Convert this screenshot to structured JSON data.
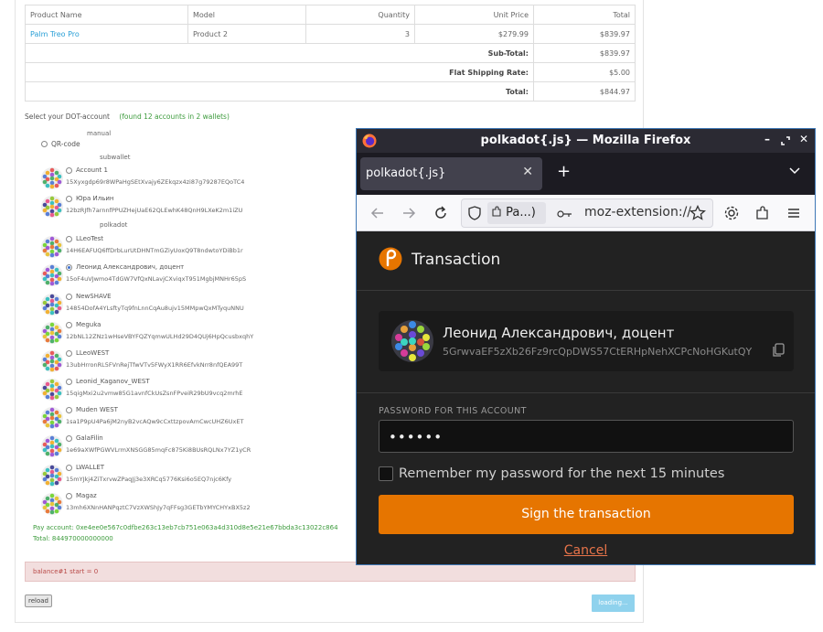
{
  "order_table": {
    "headers": [
      "Product Name",
      "Model",
      "Quantity",
      "Unit Price",
      "Total"
    ],
    "rows": [
      {
        "product": "Palm Treo Pro",
        "model": "Product 2",
        "quantity": "3",
        "unit_price": "$279.99",
        "total": "$839.97"
      }
    ],
    "totals": [
      {
        "label": "Sub-Total:",
        "value": "$839.97"
      },
      {
        "label": "Flat Shipping Rate:",
        "value": "$5.00"
      },
      {
        "label": "Total:",
        "value": "$844.97"
      }
    ]
  },
  "account_select": {
    "label": "Select your DOT-account",
    "found": "(found 12 accounts in 2 wallets)",
    "group_manual": "manual",
    "qr_label": "QR-code",
    "group_subwallet": "subwallet",
    "group_polkadot": "polkadot",
    "accounts": [
      {
        "name": "Account 1",
        "address": "15Xyxgdp69r8WPaHgSEtXvajy6ZEkqzx4zi87g79287EQoTC4",
        "selected": false
      },
      {
        "name": "Юра Ильин",
        "address": "12bzRJfh7arnnfPPUZHejUaE62QLEwhK48QnH9LXeK2m1iZU",
        "selected": false
      },
      {
        "name": "LLeoTest",
        "address": "14H6EAFUQ6ffDrbLurUtDHNTmGZiyUoxQ9T8ndwtoYDiBb1r",
        "selected": false
      },
      {
        "name": "Леонид Александрович, доцент",
        "address": "15oF4uVJwmo4TdGW7VfQxNLavjCXviqxT951MgbjMNHr65pS",
        "selected": true
      },
      {
        "name": "NewSHAVE",
        "address": "14854DofA4YLsftyTq9fnLnnCqAu8ujv15MMpwQxMTyquNNU",
        "selected": false
      },
      {
        "name": "Meguka",
        "address": "12bNL12ZNz1wHseVBYFQZYqmwULHd29D4QUj6HpQcusbxqhY",
        "selected": false
      },
      {
        "name": "LLeoWEST",
        "address": "13ubHrronRL5FVnRejTfwVTv5FWyX1RR6EfvkNrr8nfQEA99T",
        "selected": false
      },
      {
        "name": "Leonid_Kaganov_WEST",
        "address": "15qigMxi2u2vmw85G1avnfCkUsZsnFPveiR29bU9vcq2mrhE",
        "selected": false
      },
      {
        "name": "Muden WEST",
        "address": "1sa1P9pU4Pa6jM2nyB2vcAQw9cCxttzpovAmCwcUHZ6UxET",
        "selected": false
      },
      {
        "name": "GalaFilin",
        "address": "1e69aXWfPGWVLrmXNSGG85mqFc875Ki8BUsRQLNx7YZ1yCR",
        "selected": false
      },
      {
        "name": "LWALLET",
        "address": "15mYJkj4ZiTxrvwZPaqJj3e3XRCq5776Ksi6o5EQ7njc6Kfy",
        "selected": false
      },
      {
        "name": "Magaz",
        "address": "13mh6XNnHANPqztC7VzXWShJy7qFFsg3GETbYMYCHYxBX5z2",
        "selected": false
      }
    ],
    "pay_account": "Pay account: 0xe4ee0e567c0dfbe263c13eb7cb751e063a4d310d8e5e21e67bbda3c13022c864",
    "total": "Total: 844970000000000"
  },
  "alert": {
    "text": "balance#1 start = 0"
  },
  "buttons": {
    "reload": "reload",
    "loading": "loading..."
  },
  "firefox": {
    "window_title": "polkadot{.js} — Mozilla Firefox",
    "tab_title": "polkadot{.js}",
    "identity_pill": "Pa...)",
    "url": "moz-extension://"
  },
  "extension": {
    "header_title": "Transaction",
    "account_name": "Леонид Александрович, доцент",
    "account_address": "5GrwvaEF5zXb26Fz9rcQpDWS57CtERHpNehXCPcNoHGKutQY",
    "password_label": "PASSWORD FOR THIS ACCOUNT",
    "password_value": "••••••",
    "remember_label": "Remember my password for the next 15 minutes",
    "sign_button": "Sign the transaction",
    "cancel_link": "Cancel"
  },
  "colors": {
    "accent_orange": "#e67500",
    "link_blue": "#2a9fd6",
    "success_green": "#3c9b3c",
    "alert_bg": "#f2dede"
  }
}
